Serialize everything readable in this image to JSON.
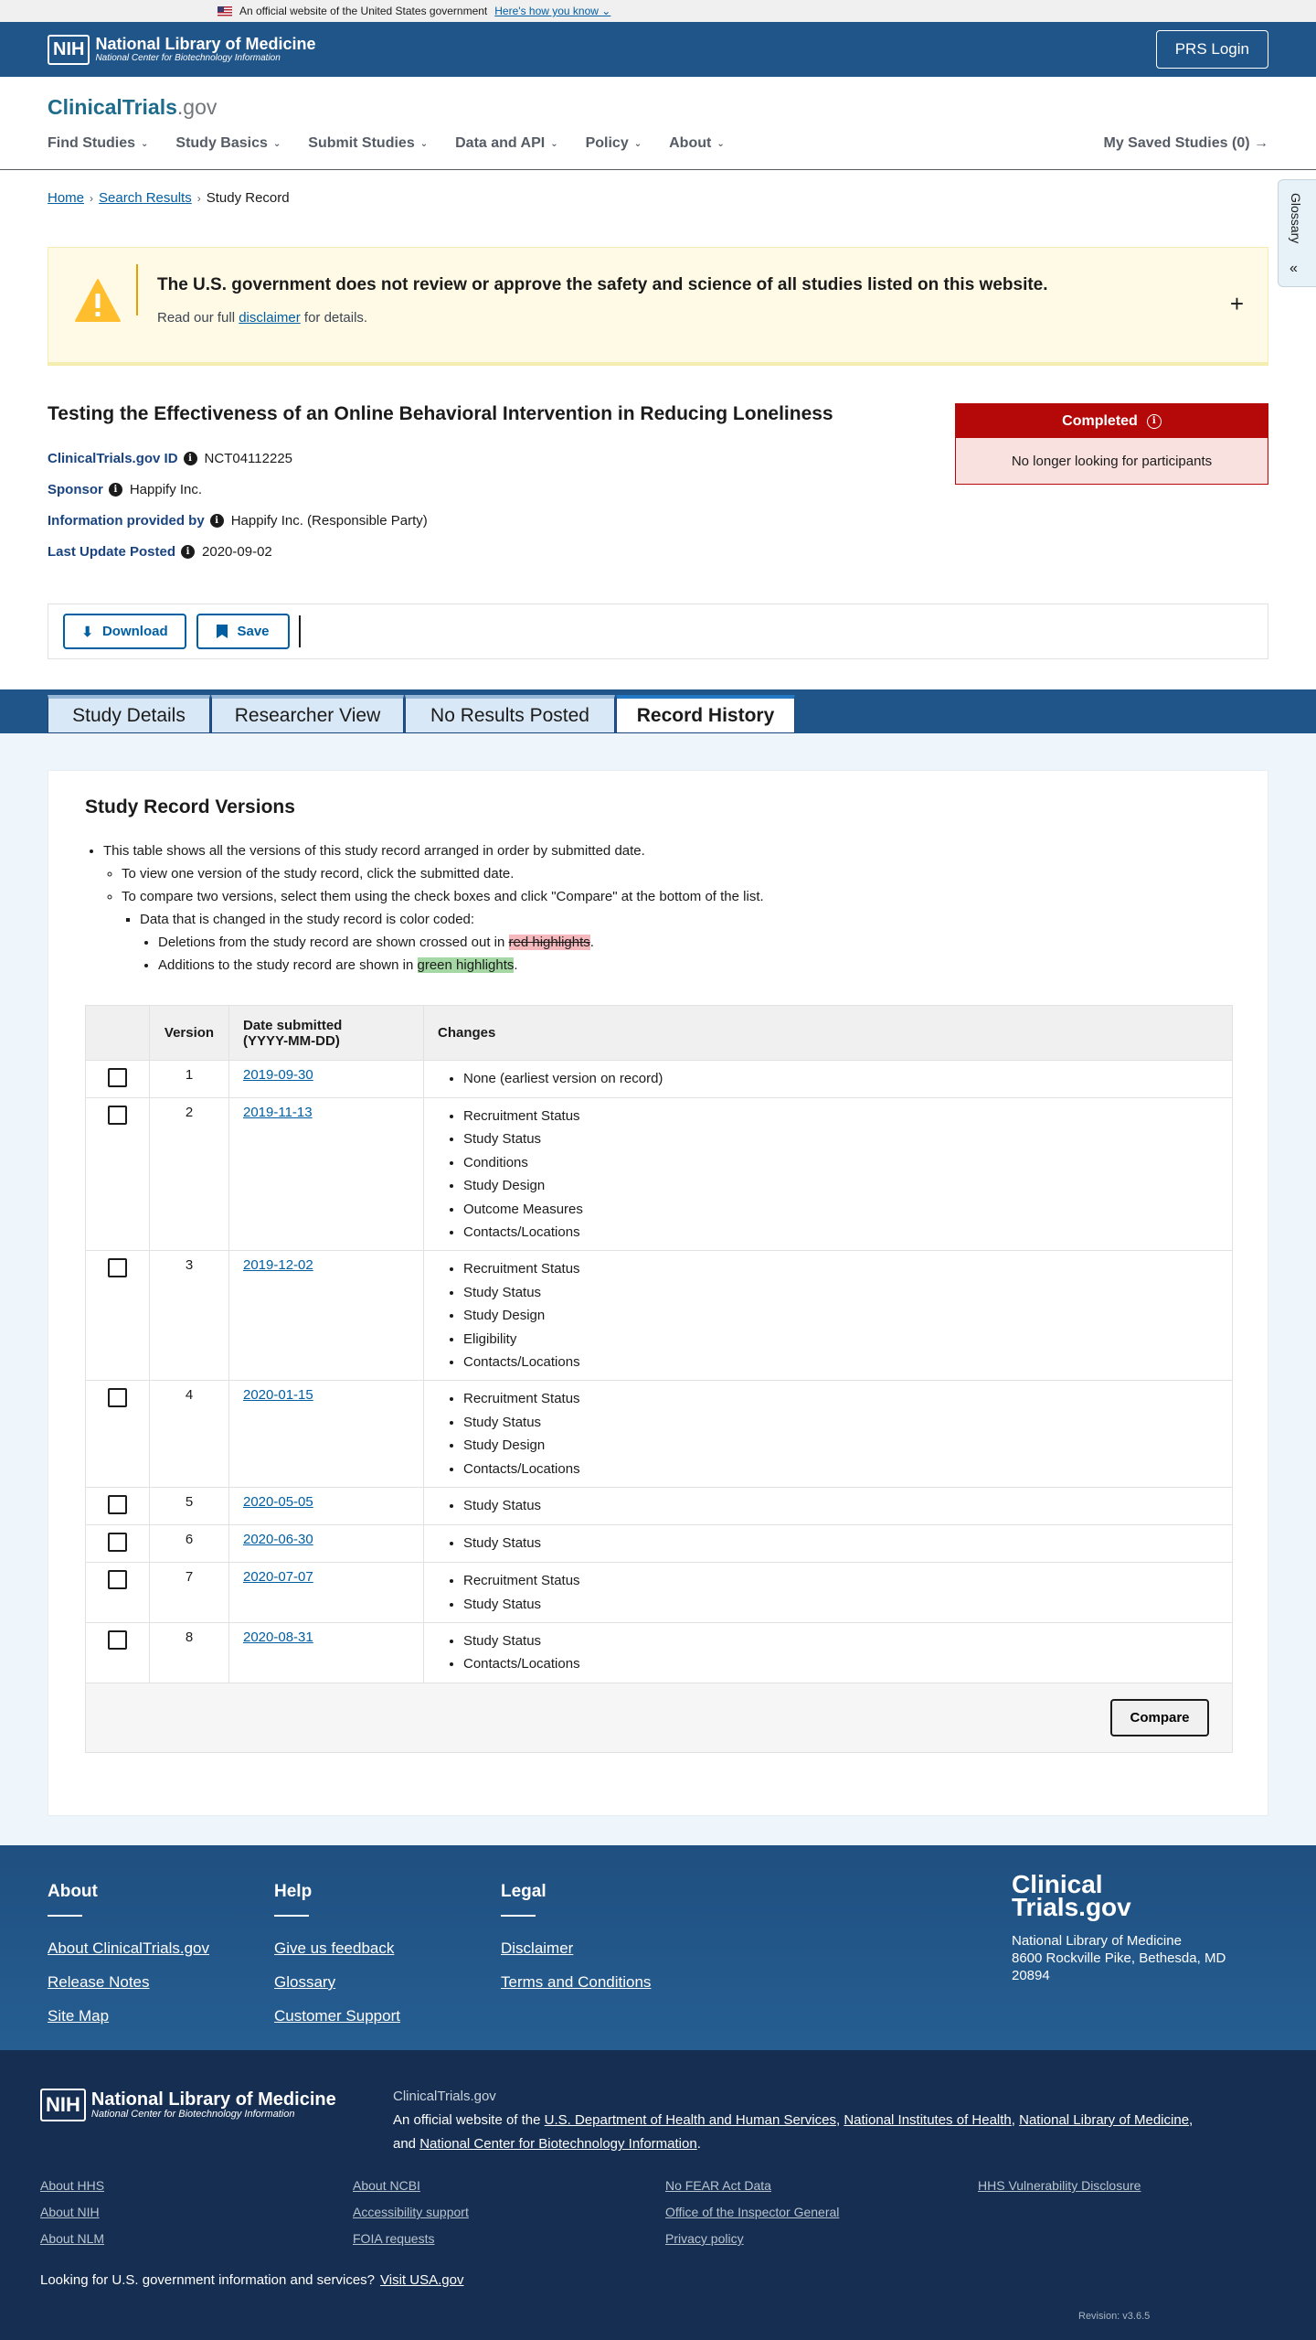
{
  "gov_banner": {
    "text": "An official website of the United States government",
    "link": "Here's how you know"
  },
  "nih_header": {
    "line1": "National Library of Medicine",
    "line2": "National Center for Biotechnology Information",
    "box": "NIH",
    "login": "PRS Login"
  },
  "ct_header": {
    "logo_main": "ClinicalTrials",
    "logo_suffix": ".gov",
    "nav": [
      "Find Studies",
      "Study Basics",
      "Submit Studies",
      "Data and API",
      "Policy",
      "About"
    ],
    "saved": "My Saved Studies (0)"
  },
  "glossary": "Glossary",
  "breadcrumb": {
    "home": "Home",
    "search": "Search Results",
    "current": "Study Record"
  },
  "alert": {
    "title": "The U.S. government does not review or approve the safety and science of all studies listed on this website.",
    "sub_pre": "Read our full ",
    "sub_link": "disclaimer",
    "sub_post": " for details."
  },
  "study": {
    "title": "Testing the Effectiveness of an Online Behavioral Intervention in Reducing Loneliness",
    "id_label": "ClinicalTrials.gov ID",
    "id": "NCT04112225",
    "sponsor_label": "Sponsor",
    "sponsor": "Happify Inc.",
    "info_label": "Information provided by",
    "info": "Happify Inc. (Responsible Party)",
    "update_label": "Last Update Posted",
    "update": "2020-09-02",
    "status": "Completed",
    "status_sub": "No longer looking for participants"
  },
  "actions": {
    "download": "Download",
    "save": "Save"
  },
  "tabs": [
    "Study Details",
    "Researcher View",
    "No Results Posted",
    "Record History"
  ],
  "versions": {
    "title": "Study Record Versions",
    "bullet1": "This table shows all the versions of this study record arranged in order by submitted date.",
    "bullet2": "To view one version of the study record, click the submitted date.",
    "bullet3": "To compare two versions, select them using the check boxes and click \"Compare\" at the bottom of the list.",
    "bullet4": "Data that is changed in the study record is color coded:",
    "del_pre": "Deletions from the study record are shown crossed out in ",
    "del_hl": "red highlights",
    "add_pre": "Additions to the study record are shown in ",
    "add_hl": "green highlights",
    "headers": {
      "version": "Version",
      "date1": "Date submitted",
      "date2": "(YYYY-MM-DD)",
      "changes": "Changes"
    },
    "rows": [
      {
        "version": "1",
        "date": "2019-09-30",
        "changes": [
          "None (earliest version on record)"
        ]
      },
      {
        "version": "2",
        "date": "2019-11-13",
        "changes": [
          "Recruitment Status",
          "Study Status",
          "Conditions",
          "Study Design",
          "Outcome Measures",
          "Contacts/Locations"
        ]
      },
      {
        "version": "3",
        "date": "2019-12-02",
        "changes": [
          "Recruitment Status",
          "Study Status",
          "Study Design",
          "Eligibility",
          "Contacts/Locations"
        ]
      },
      {
        "version": "4",
        "date": "2020-01-15",
        "changes": [
          "Recruitment Status",
          "Study Status",
          "Study Design",
          "Contacts/Locations"
        ]
      },
      {
        "version": "5",
        "date": "2020-05-05",
        "changes": [
          "Study Status"
        ]
      },
      {
        "version": "6",
        "date": "2020-06-30",
        "changes": [
          "Study Status"
        ]
      },
      {
        "version": "7",
        "date": "2020-07-07",
        "changes": [
          "Recruitment Status",
          "Study Status"
        ]
      },
      {
        "version": "8",
        "date": "2020-08-31",
        "changes": [
          "Study Status",
          "Contacts/Locations"
        ]
      }
    ],
    "compare": "Compare"
  },
  "footer": {
    "about": {
      "title": "About",
      "links": [
        "About ClinicalTrials.gov",
        "Release Notes",
        "Site Map"
      ]
    },
    "help": {
      "title": "Help",
      "links": [
        "Give us feedback",
        "Glossary",
        "Customer Support"
      ]
    },
    "legal": {
      "title": "Legal",
      "links": [
        "Disclaimer",
        "Terms and Conditions"
      ]
    },
    "logo1": "Clinical",
    "logo2": "Trials.gov",
    "addr1": "National Library of Medicine",
    "addr2": "8600 Rockville Pike, Bethesda, MD 20894"
  },
  "footer2": {
    "nih_line1": "National Library of Medicine",
    "nih_line2": "National Center for Biotechnology Information",
    "site": "ClinicalTrials.gov",
    "official_pre": "An official website of the ",
    "hhs": "U.S. Department of Health and Human Services",
    "nih": "National Institutes of Health",
    "nlm": "National Library of Medicine",
    "and": "and ",
    "ncbi": "National Center for Biotechnology Information",
    "links_col1": [
      "About HHS",
      "About NIH",
      "About NLM"
    ],
    "links_col2": [
      "About NCBI",
      "Accessibility support",
      "FOIA requests"
    ],
    "links_col3": [
      "No FEAR Act Data",
      "Office of the Inspector General",
      "Privacy policy"
    ],
    "links_col4": [
      "HHS Vulnerability Disclosure"
    ],
    "looking": "Looking for U.S. government information and services?",
    "usa": "Visit USA.gov",
    "revision": "Revision: v3.6.5"
  },
  "colors": {
    "nih_blue": "#20558a",
    "status_red": "#b50909",
    "link": "#005ea2",
    "footer_dark": "#162e51"
  }
}
